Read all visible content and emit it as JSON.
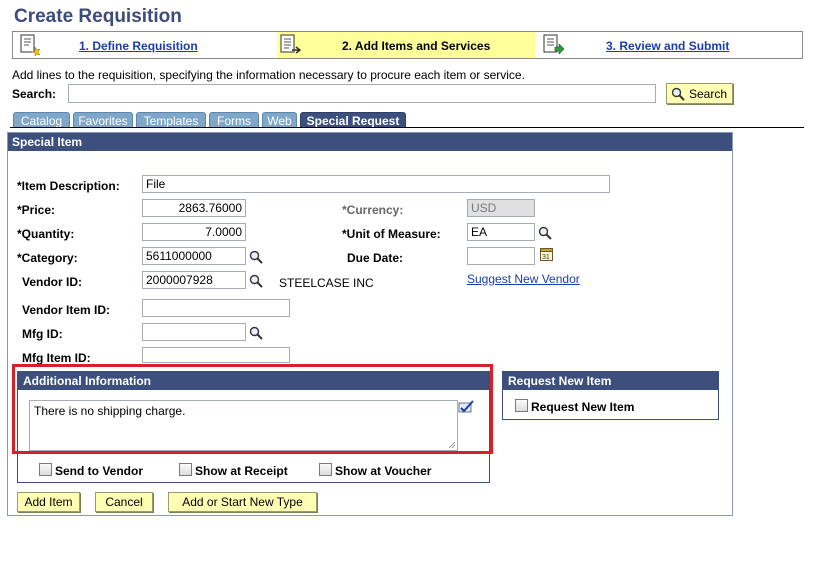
{
  "page": {
    "title": "Create Requisition",
    "instruction": "Add lines to the requisition, specifying the information necessary to procure each item or service."
  },
  "steps": [
    {
      "label": "1. Define Requisition",
      "state": "link"
    },
    {
      "label": "2. Add Items and Services",
      "state": "current"
    },
    {
      "label": "3. Review and Submit",
      "state": "link"
    }
  ],
  "search": {
    "label": "Search:",
    "value": "",
    "button": "Search"
  },
  "tabs": [
    "Catalog",
    "Favorites",
    "Templates",
    "Forms",
    "Web",
    "Special Request"
  ],
  "active_tab": "Special Request",
  "special_item": {
    "header": "Special Item",
    "item_description": {
      "label": "*Item Description:",
      "value": "File"
    },
    "price": {
      "label": "*Price:",
      "value": "2863.76000"
    },
    "quantity": {
      "label": "*Quantity:",
      "value": "7.0000"
    },
    "category": {
      "label": "*Category:",
      "value": "5611000000"
    },
    "vendor_id": {
      "label": "Vendor ID:",
      "value": "2000007928",
      "vendor_name": "STEELCASE INC"
    },
    "vendor_item_id": {
      "label": "Vendor Item ID:",
      "value": ""
    },
    "mfg_id": {
      "label": "Mfg ID:",
      "value": ""
    },
    "mfg_item_id": {
      "label": "Mfg Item ID:",
      "value": ""
    },
    "currency": {
      "label": "*Currency:",
      "value": "USD"
    },
    "unit_of_measure": {
      "label": "*Unit of Measure:",
      "value": "EA"
    },
    "due_date": {
      "label": "Due Date:",
      "value": ""
    },
    "suggest_vendor": "Suggest New Vendor"
  },
  "additional_info": {
    "header": "Additional Information",
    "text": "There is no shipping charge.",
    "send_to_vendor": "Send to Vendor",
    "show_at_receipt": "Show at Receipt",
    "show_at_voucher": "Show at Voucher"
  },
  "request_new_item": {
    "header": "Request New Item",
    "checkbox": "Request New Item"
  },
  "buttons": {
    "add_item": "Add Item",
    "cancel": "Cancel",
    "add_or_start": "Add or Start New Type"
  },
  "colors": {
    "header_blue": "#3d4f7d",
    "tab_blue": "#7fa7c9",
    "step_highlight": "#ffff99",
    "button_yellow": "#ffffb3",
    "highlight_red": "#d2232a",
    "link_blue": "#1a3ea8"
  }
}
